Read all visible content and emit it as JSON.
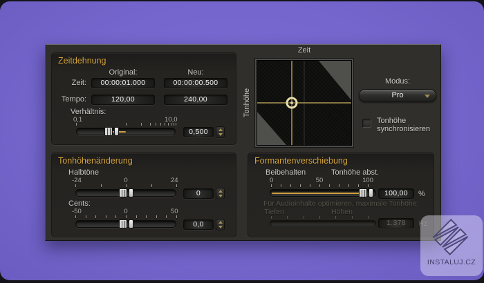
{
  "dialog": {
    "zeitdehnung": {
      "title": "Zeitdehnung",
      "col_original": "Original:",
      "col_neu": "Neu:",
      "zeit_label": "Zeit:",
      "zeit_original": "00:00:01.000",
      "zeit_neu": "00:00:00.500",
      "tempo_label": "Tempo:",
      "tempo_original": "120,00",
      "tempo_neu": "240,00",
      "verhaeltnis_label": "Verhältnis:",
      "scale_min": "0,1",
      "scale_max": "10,0",
      "verhaeltnis_value": "0,500"
    },
    "graph": {
      "x_label": "Zeit",
      "y_label": "Tonhöhe"
    },
    "modus": {
      "label": "Modus:",
      "value": "Pro"
    },
    "sync_checkbox": {
      "line1": "Tonhöhe",
      "line2": "synchronisieren",
      "checked": false
    },
    "tonhoehe": {
      "title": "Tonhöhenänderung",
      "halbtoene_label": "Halbtöne",
      "halbtoene_min": "-24",
      "halbtoene_mid": "0",
      "halbtoene_max": "24",
      "halbtoene_value": "0",
      "cents_label": "Cents:",
      "cents_min": "-50",
      "cents_mid": "0",
      "cents_max": "50",
      "cents_value": "0,0"
    },
    "formant": {
      "title": "Formantenverschiebung",
      "left_label": "Beibehalten",
      "right_label": "Tonhöhe abst.",
      "scale_min": "0",
      "scale_mid": "50",
      "scale_max": "100",
      "value": "100,00",
      "unit": "%",
      "disabled_text": "Für Audioinhalte optimieren, maximale Tonhöhe:",
      "tiefen_label": "Tiefen",
      "hoehen_label": "Höhen",
      "freq_value": "1.378",
      "freq_unit": "Hz"
    }
  },
  "watermark": {
    "text": "INSTALUJ.CZ"
  },
  "colors": {
    "accent_gold": "#cfa03b",
    "purple": "#7466cc",
    "dialog_bg": "#302f2c"
  },
  "ticks": {
    "verhaeltnis": [
      0,
      50,
      65,
      74,
      80.1,
      84.9,
      88.9,
      92.3,
      95.2,
      97.7,
      100
    ],
    "halbtoene": [
      0,
      25,
      50,
      75,
      100
    ],
    "cents": [
      0,
      10,
      20,
      30,
      40,
      50,
      60,
      70,
      80,
      90,
      100
    ],
    "formant": [
      0,
      10,
      20,
      30,
      40,
      50,
      60,
      70,
      80,
      90,
      100
    ],
    "formant_freq": [
      0,
      16.7,
      33.3,
      50,
      66.7,
      83.3,
      100
    ]
  }
}
